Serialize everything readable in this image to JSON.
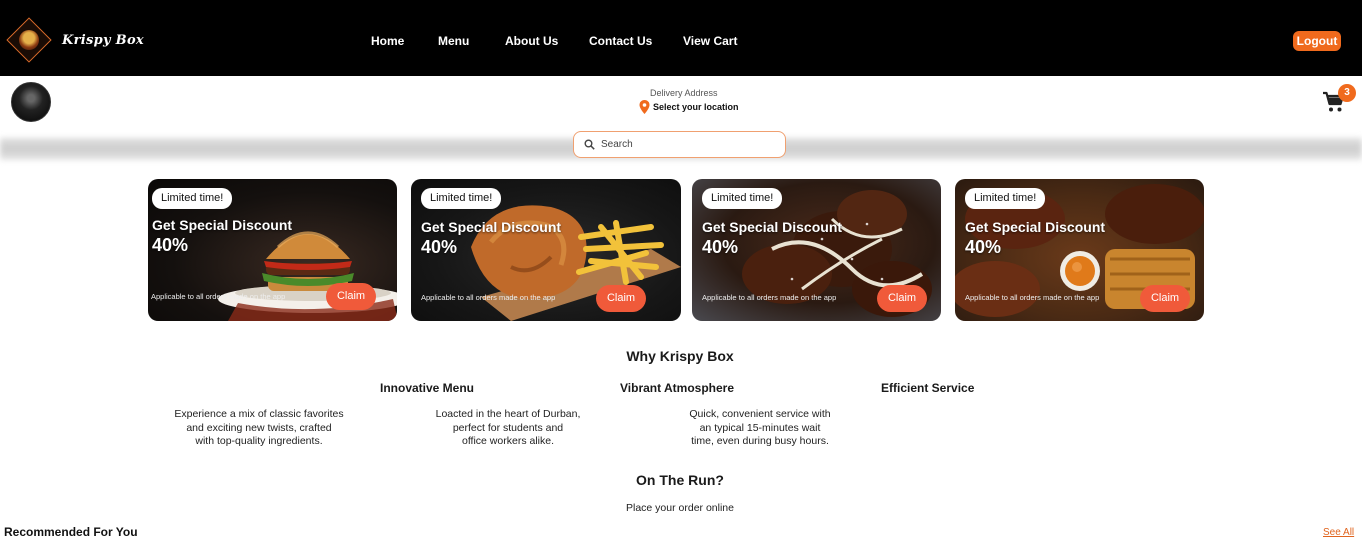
{
  "header": {
    "brand": "Krispy Box",
    "nav": [
      "Home",
      "Menu",
      "About Us",
      "Contact Us",
      "View Cart"
    ],
    "logout_label": "Logout"
  },
  "location": {
    "label": "Delivery Address",
    "value": "Select your location"
  },
  "cart": {
    "count": "3"
  },
  "search": {
    "placeholder": "Search"
  },
  "promos": [
    {
      "badge": "Limited time!",
      "title": "Get Special Discount",
      "discount": "40%",
      "note": "Applicable to all orders made on the app",
      "cta": "Claim"
    },
    {
      "badge": "Limited time!",
      "title": "Get Special Discount",
      "discount": "40%",
      "note": "Applicable to all orders made on the app",
      "cta": "Claim"
    },
    {
      "badge": "Limited time!",
      "title": "Get Special Discount",
      "discount": "40%",
      "note": "Applicable to all orders made on the app",
      "cta": "Claim"
    },
    {
      "badge": "Limited time!",
      "title": "Get Special Discount",
      "discount": "40%",
      "note": "Applicable to all orders made on the app",
      "cta": "Claim"
    }
  ],
  "why": {
    "heading": "Why Krispy Box",
    "features": [
      "Innovative Menu",
      "Vibrant Atmosphere",
      "Efficient Service"
    ],
    "descriptions": [
      [
        "Experience a mix of classic favorites",
        "and exciting new twists, crafted",
        "with top-quality ingredients."
      ],
      [
        "Loacted in the heart of Durban,",
        "perfect for students and",
        "office workers alike."
      ],
      [
        "Quick, convenient service with",
        "an typical 15-minutes wait",
        "time, even during busy hours."
      ]
    ]
  },
  "on_the_run": {
    "heading": "On The Run?",
    "subtitle": "Place your order online"
  },
  "recommended": {
    "heading": "Recommended For You",
    "see_all": "See All"
  },
  "colors": {
    "accent": "#f06a1d",
    "claim": "#f05a3a",
    "topbar": "#000000"
  }
}
